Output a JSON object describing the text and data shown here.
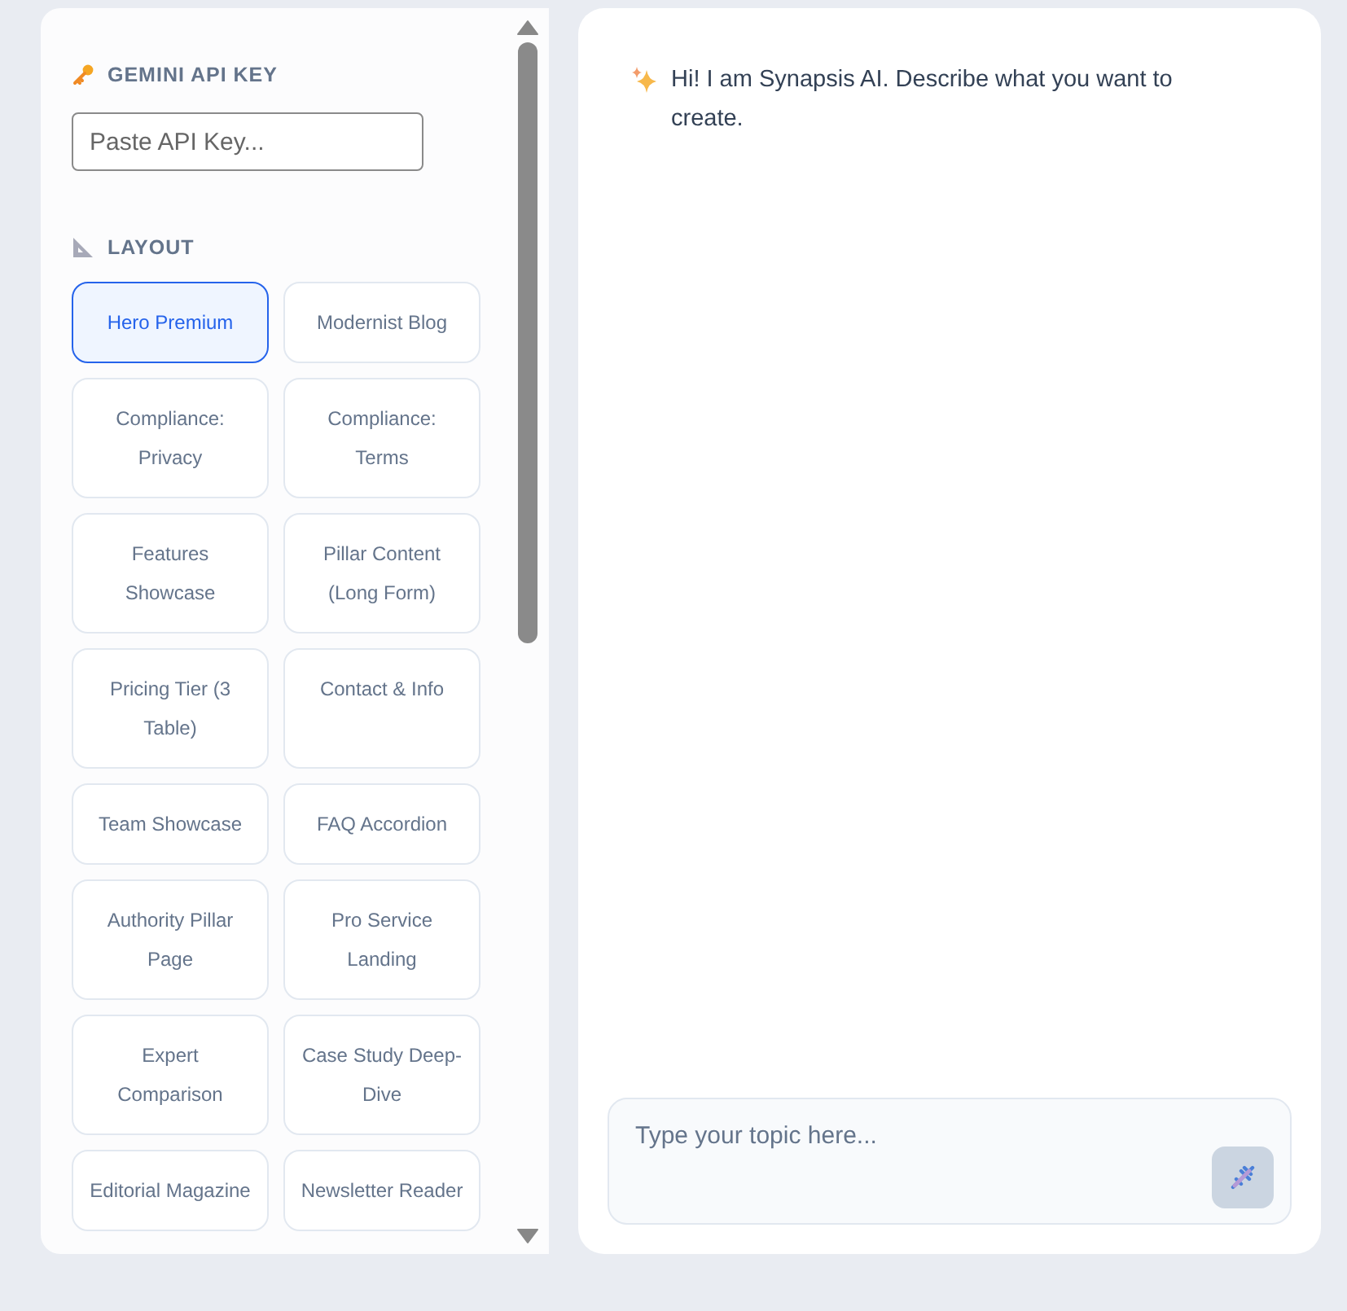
{
  "api_key": {
    "heading": "GEMINI API KEY",
    "placeholder": "Paste API Key..."
  },
  "layout": {
    "heading": "LAYOUT",
    "options": [
      {
        "label": "Hero Premium",
        "selected": true
      },
      {
        "label": "Modernist Blog",
        "selected": false
      },
      {
        "label": "Compliance: Privacy",
        "selected": false
      },
      {
        "label": "Compliance: Terms",
        "selected": false
      },
      {
        "label": "Features Showcase",
        "selected": false
      },
      {
        "label": "Pillar Content (Long Form)",
        "selected": false
      },
      {
        "label": "Pricing Tier (3 Table)",
        "selected": false
      },
      {
        "label": "Contact & Info",
        "selected": false
      },
      {
        "label": "Team Showcase",
        "selected": false
      },
      {
        "label": "FAQ Accordion",
        "selected": false
      },
      {
        "label": "Authority Pillar Page",
        "selected": false
      },
      {
        "label": "Pro Service Landing",
        "selected": false
      },
      {
        "label": "Expert Comparison",
        "selected": false
      },
      {
        "label": "Case Study Deep-Dive",
        "selected": false
      },
      {
        "label": "Editorial Magazine",
        "selected": false
      },
      {
        "label": "Newsletter Reader",
        "selected": false
      }
    ]
  },
  "chat": {
    "message": "Hi! I am Synapsis AI. Describe what you want to create.",
    "input_placeholder": "Type your topic here..."
  }
}
